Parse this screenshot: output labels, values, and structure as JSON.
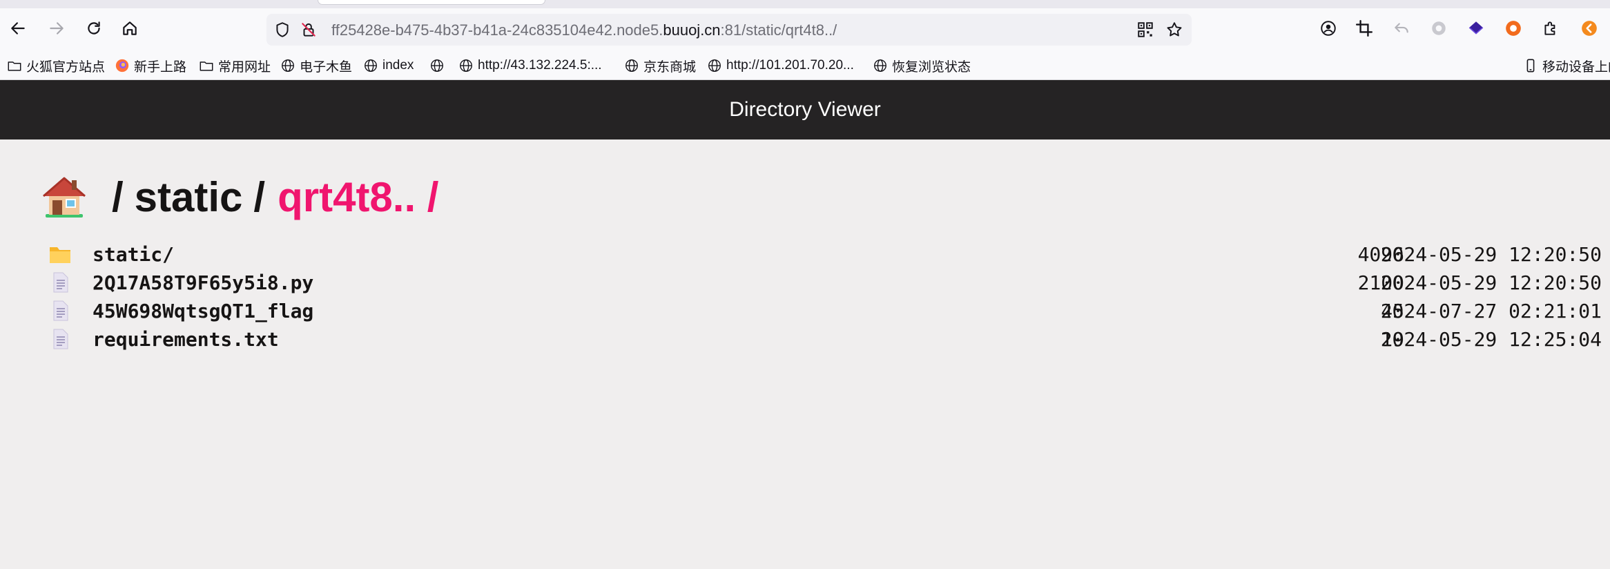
{
  "browser": {
    "url_prefix": "ff25428e-b475-4b37-b41a-24c835104e42.node5.",
    "url_host": "buuoj.cn",
    "url_suffix": ":81/static/qrt4t8../"
  },
  "bookmarks": [
    {
      "label": "火狐官方站点",
      "icon": "folder-icon"
    },
    {
      "label": "新手上路",
      "icon": "firefox-icon"
    },
    {
      "label": "常用网址",
      "icon": "folder-icon"
    },
    {
      "label": "电子木鱼",
      "icon": "globe-icon"
    },
    {
      "label": "index",
      "icon": "globe-icon"
    },
    {
      "label": "",
      "icon": "globe-icon"
    },
    {
      "label": "http://43.132.224.5:...",
      "icon": "globe-icon"
    },
    {
      "label": "京东商城",
      "icon": "globe-icon"
    },
    {
      "label": "http://101.201.70.20...",
      "icon": "globe-icon"
    },
    {
      "label": "恢复浏览状态",
      "icon": "globe-icon"
    },
    {
      "label": "移动设备上的",
      "icon": "mobile-icon"
    }
  ],
  "page": {
    "title": "Directory Viewer",
    "breadcrumb": {
      "root": "/",
      "parent": "static",
      "separator": "/",
      "current": "qrt4t8.. /"
    },
    "files": [
      {
        "name": "static/",
        "size": "4096",
        "date": "2024-05-29 12:20:50",
        "type": "folder"
      },
      {
        "name": "2Q17A58T9F65y5i8.py",
        "size": "2100",
        "date": "2024-05-29 12:20:50",
        "type": "file"
      },
      {
        "name": "45W698WqtsgQT1_flag",
        "size": "45",
        "date": "2024-07-27 02:21:01",
        "type": "file"
      },
      {
        "name": "requirements.txt",
        "size": "19",
        "date": "2024-05-29 12:25:04",
        "type": "file"
      }
    ]
  },
  "colors": {
    "header_bg": "#252324",
    "page_bg": "#f0eeee",
    "accent": "#f0156e"
  }
}
